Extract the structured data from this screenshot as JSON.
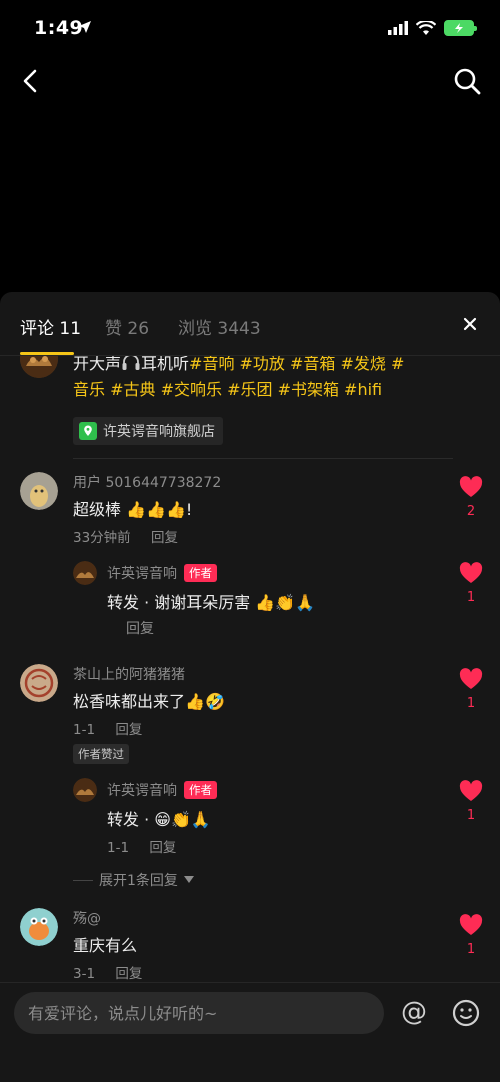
{
  "status": {
    "time": "1:49"
  },
  "tabs": [
    {
      "label": "评论 11",
      "active": true
    },
    {
      "label": "赞 26",
      "active": false
    },
    {
      "label": "浏览 3443",
      "active": false
    }
  ],
  "post": {
    "text_prefix": "开大声",
    "text_mid": "耳机听",
    "hashtags_line1": "#音响 #功放 #音箱 #发烧 #",
    "hashtags_line2": "音乐 #古典 #交响乐 #乐团 #书架箱 #hifi",
    "shop": "许英谔音响旗舰店"
  },
  "comments": [
    {
      "user": "用户 5016447738272",
      "text": "超级棒",
      "text_suffix": "!",
      "time": "33分钟前",
      "reply_label": "回复",
      "likes": "2",
      "reply": {
        "user": "许英谔音响",
        "badge": "作者",
        "text": "转发 · 谢谢耳朵厉害",
        "reply_label": "回复",
        "likes": "1"
      }
    },
    {
      "user": "茶山上的阿猪猪猪",
      "text": "松香味都出来了",
      "time": "1-1",
      "reply_label": "回复",
      "liked_badge": "作者赞过",
      "likes": "1",
      "reply": {
        "user": "许英谔音响",
        "badge": "作者",
        "text": "转发 ·",
        "time": "1-1",
        "reply_label": "回复",
        "likes": "1"
      },
      "expand": "展开1条回复"
    },
    {
      "user": "殇@",
      "text": "重庆有么",
      "time": "3-1",
      "reply_label": "回复",
      "likes": "1"
    }
  ],
  "input": {
    "placeholder": "有爱评论，说点儿好听的~",
    "at": "@"
  },
  "colors": {
    "accent": "#f5c518",
    "like": "#fe2c55",
    "sheet_bg": "#171717"
  }
}
